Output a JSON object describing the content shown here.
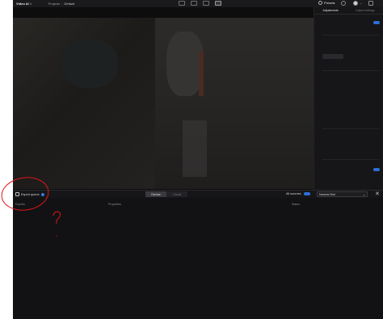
{
  "titlebar": {
    "app_title": "Video AI",
    "app_title_arrow": "∨",
    "breadcrumb": [
      "Projects",
      "Default"
    ],
    "breadcrumb_sep": "›",
    "presets_label": "Presets",
    "account_arrow": "⌄"
  },
  "sidebar": {
    "tabs": [
      "Adjustments",
      "Output settings"
    ],
    "active_tab": 0
  },
  "export_bar": {
    "title": "Export queue",
    "info_icon": "i",
    "segments": [
      "Device",
      "Cloud"
    ],
    "active_segment": 0,
    "all_sources_label": "All sources",
    "sort_value": "Newest first",
    "sort_arrow": "⌄",
    "close_symbol": "✕"
  },
  "queue_table": {
    "columns": [
      "Exports",
      "Properties",
      "Status"
    ]
  },
  "annotation": {
    "question_mark": "?",
    "circle_color": "#e0151b"
  },
  "colors": {
    "accent": "#2d6fd6",
    "app_bg": "#121214",
    "annotation": "#e0151b"
  }
}
